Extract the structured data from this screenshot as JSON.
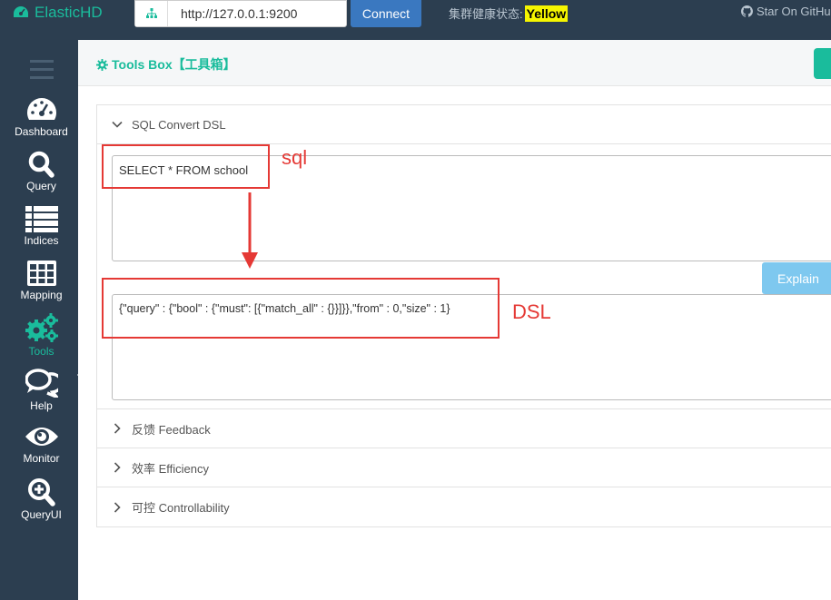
{
  "navbar": {
    "brand": "ElasticHD",
    "url_value": "http://127.0.0.1:9200",
    "connect_label": "Connect",
    "health_label": "集群健康状态:",
    "health_value": "Yellow",
    "star_label": "Star On GitHub"
  },
  "sidebar": {
    "items": [
      {
        "label": "Dashboard",
        "icon": "dashboard-icon"
      },
      {
        "label": "Query",
        "icon": "search-icon"
      },
      {
        "label": "Indices",
        "icon": "list-icon"
      },
      {
        "label": "Mapping",
        "icon": "table-icon"
      },
      {
        "label": "Tools",
        "icon": "gears-icon"
      },
      {
        "label": "Help",
        "icon": "comments-icon"
      },
      {
        "label": "Monitor",
        "icon": "eye-icon"
      },
      {
        "label": "QueryUI",
        "icon": "search-plus-icon"
      }
    ]
  },
  "main": {
    "title": "Tools Box【工具箱】",
    "sections": [
      {
        "label": "SQL Convert DSL",
        "expanded": true
      },
      {
        "label": "反馈 Feedback",
        "expanded": false
      },
      {
        "label": "效率 Efficiency",
        "expanded": false
      },
      {
        "label": "可控 Controllability",
        "expanded": false
      }
    ],
    "sql_value": "SELECT * FROM school",
    "dsl_value": "{\"query\" : {\"bool\" : {\"must\": [{\"match_all\" : {}}]}},\"from\" : 0,\"size\" : 1}",
    "explain_label": "Explain"
  },
  "annotations": {
    "sql_label": "sql",
    "dsl_label": "DSL"
  },
  "colors": {
    "accent": "#1abc9c",
    "navbar": "#2c3e50",
    "annotation": "#e53935",
    "health_badge": "#f5f500"
  }
}
